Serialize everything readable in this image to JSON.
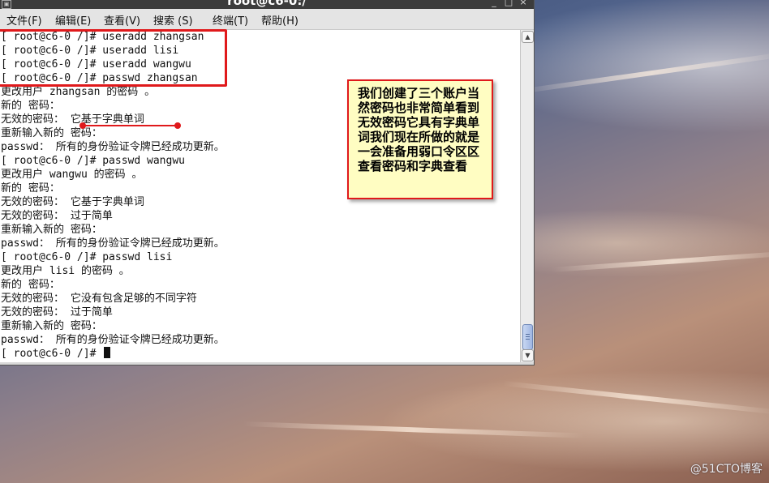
{
  "window": {
    "title": "root@c6-0:/",
    "controls": [
      "_",
      "□",
      "×"
    ]
  },
  "menubar": {
    "items": [
      "文件(F)",
      "编辑(E)",
      "查看(V)",
      "搜索 (S)",
      "终端(T)",
      "帮助(H)"
    ]
  },
  "terminal": {
    "lines": [
      "[ root@c6-0 /]# useradd zhangsan",
      "[ root@c6-0 /]# useradd lisi",
      "[ root@c6-0 /]# useradd wangwu",
      "[ root@c6-0 /]# passwd zhangsan",
      "更改用户 zhangsan 的密码 。",
      "新的 密码：",
      "无效的密码： 它基于字典单词",
      "重新输入新的 密码：",
      "passwd： 所有的身份验证令牌已经成功更新。",
      "[ root@c6-0 /]# passwd wangwu",
      "更改用户 wangwu 的密码 。",
      "新的 密码：",
      "无效的密码： 它基于字典单词",
      "无效的密码： 过于简单",
      "重新输入新的 密码：",
      "passwd： 所有的身份验证令牌已经成功更新。",
      "[ root@c6-0 /]# passwd lisi",
      "更改用户 lisi 的密码 。",
      "新的 密码：",
      "无效的密码： 它没有包含足够的不同字符",
      "无效的密码： 过于简单",
      "重新输入新的 密码：",
      "passwd： 所有的身份验证令牌已经成功更新。",
      "[ root@c6-0 /]# "
    ]
  },
  "annotation": {
    "text": "我们创建了三个账户当然密码也非常简单看到无效密码它具有字典单词我们现在所做的就是一会准备用弱口令区区查看密码和字典查看"
  },
  "watermark": "@51CTO博客",
  "colors": {
    "highlight": "#e0191b",
    "note_background": "#fffdc2"
  }
}
